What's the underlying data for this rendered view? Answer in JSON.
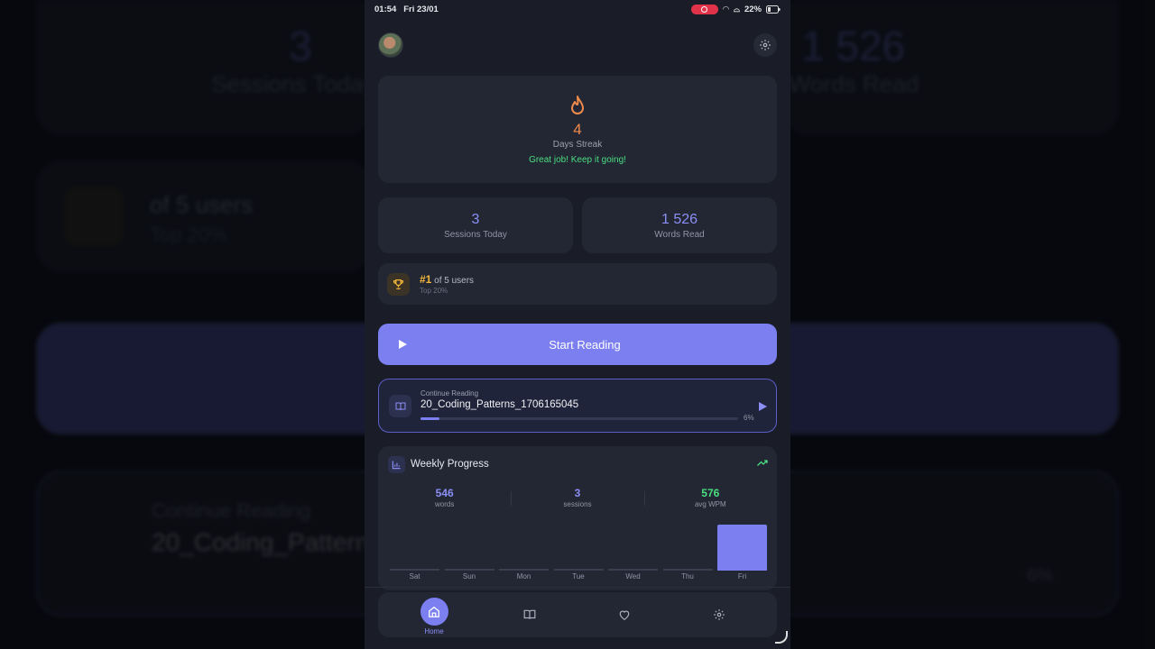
{
  "status_bar": {
    "time": "01:54",
    "date": "Fri 23/01",
    "battery": "22%"
  },
  "header": {
    "avatar_icon": "user-avatar",
    "settings_icon": "gear-icon"
  },
  "streak": {
    "count": "4",
    "label": "Days Streak",
    "message": "Great job! Keep it going!",
    "icon": "flame-icon",
    "accent": "#f08a4b"
  },
  "stats": {
    "sessions": {
      "value": "3",
      "label": "Sessions Today"
    },
    "words": {
      "value": "1 526",
      "label": "Words Read"
    }
  },
  "rank": {
    "position": "#1",
    "of_users": "of 5 users",
    "subtitle": "Top 20%",
    "icon": "trophy-icon",
    "accent": "#f5b73a"
  },
  "start_button": {
    "label": "Start Reading",
    "icon": "play-icon",
    "color": "#7b7ff0"
  },
  "continue_reading": {
    "label": "Continue Reading",
    "title": "20_Coding_Patterns_1706165045",
    "progress_text": "6%",
    "progress": 0.06,
    "icon": "book-icon"
  },
  "weekly_progress": {
    "title": "Weekly Progress",
    "stats": [
      {
        "value": "546",
        "label": "words",
        "color": "#8b8ff5"
      },
      {
        "value": "3",
        "label": "sessions",
        "color": "#8b8ff5"
      },
      {
        "value": "576",
        "label": "avg WPM",
        "color": "#4ade80"
      }
    ],
    "chart_data": {
      "type": "bar",
      "categories": [
        "Sat",
        "Sun",
        "Mon",
        "Tue",
        "Wed",
        "Thu",
        "Fri"
      ],
      "values": [
        0,
        0,
        0,
        0,
        0,
        0,
        546
      ]
    }
  },
  "bottom_nav": {
    "items": [
      {
        "label": "Home",
        "icon": "home-icon",
        "active": true
      },
      {
        "label": "",
        "icon": "book-icon",
        "active": false
      },
      {
        "label": "",
        "icon": "heart-icon",
        "active": false
      },
      {
        "label": "",
        "icon": "gear-icon",
        "active": false
      }
    ]
  }
}
